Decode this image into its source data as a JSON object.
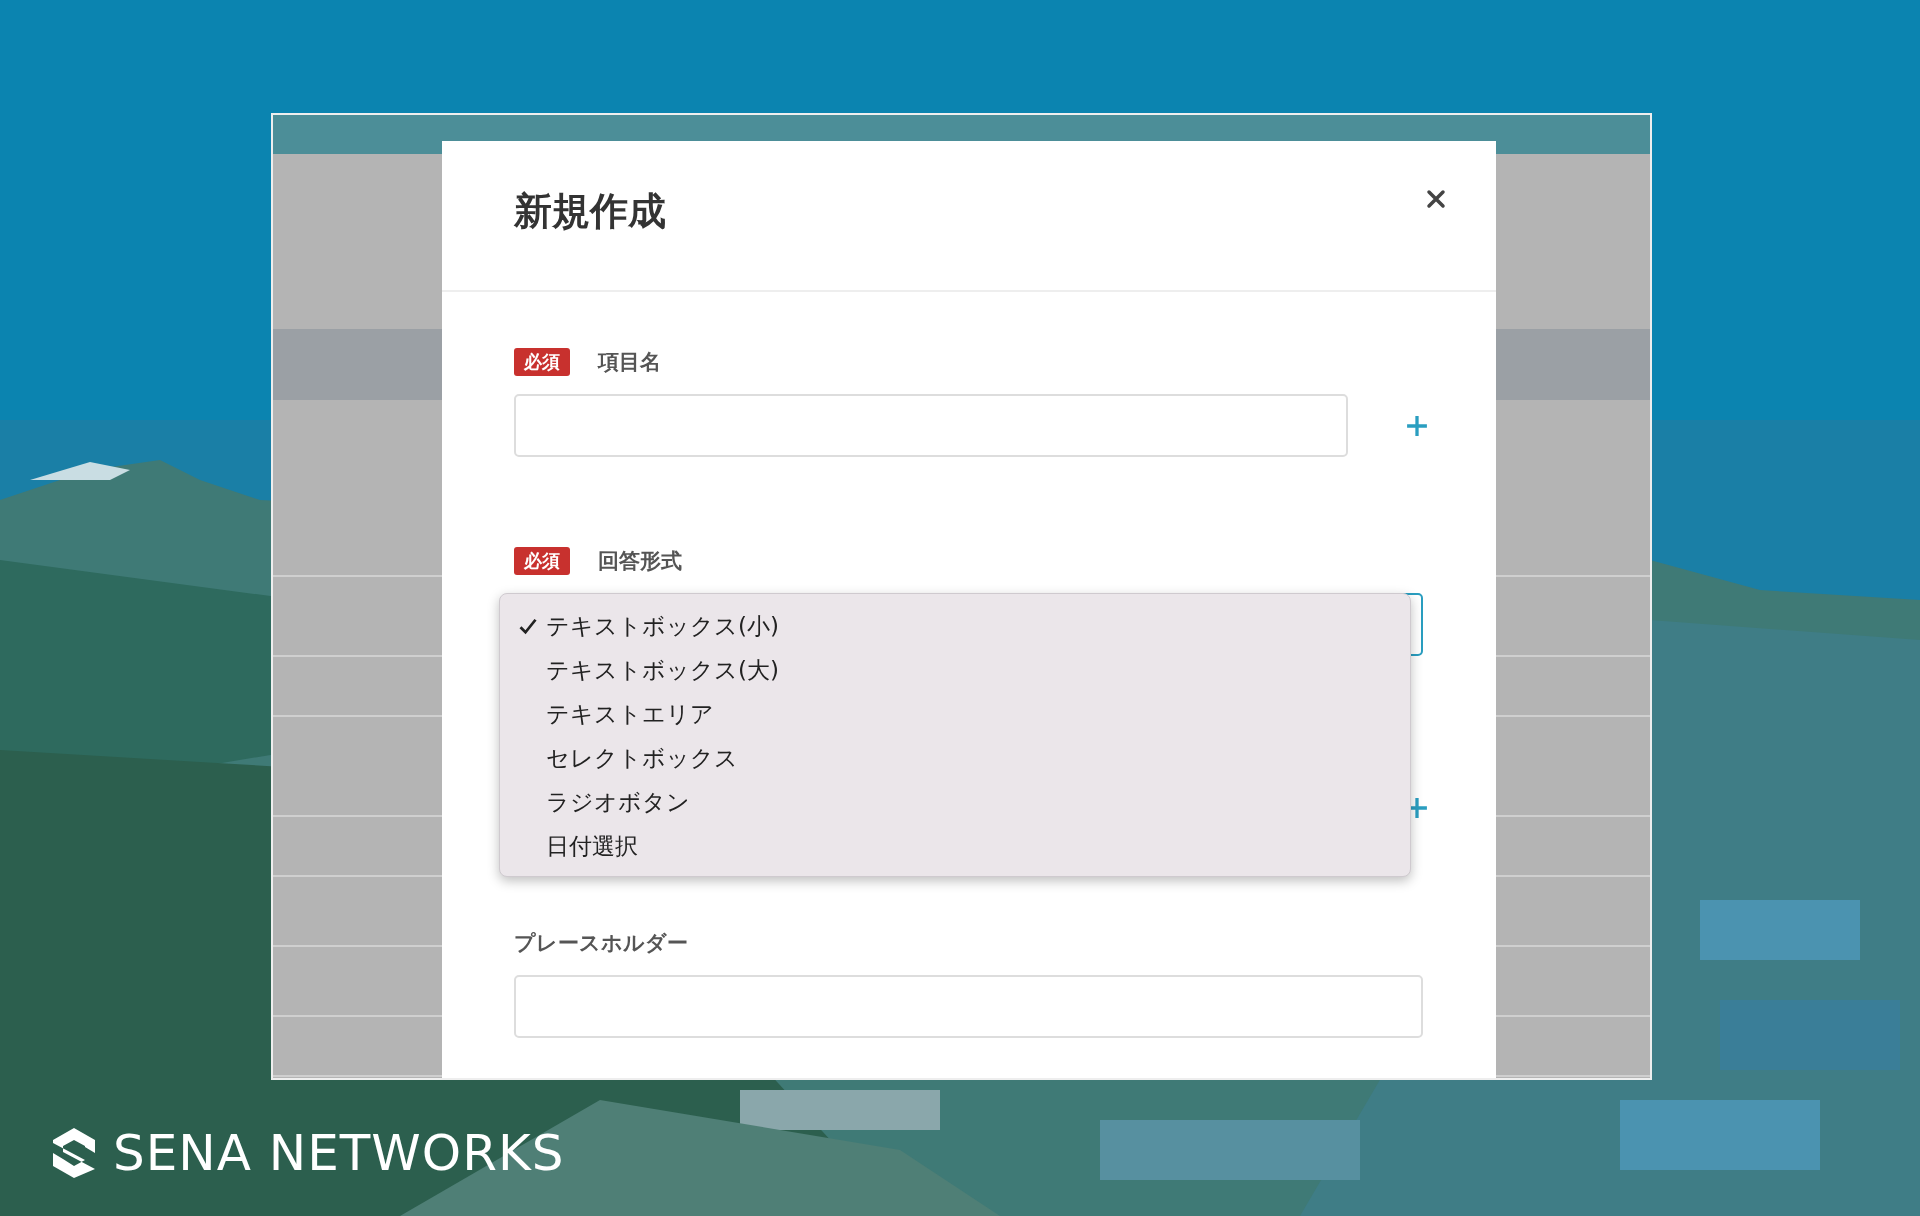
{
  "modal": {
    "title": "新規作成",
    "fields": [
      {
        "kind": "text",
        "badge": "必須",
        "label": "項目名",
        "add": true
      },
      {
        "kind": "select",
        "badge": "必須",
        "label": "回答形式",
        "options": [
          {
            "label": "テキストボックス(小)",
            "selected": true
          },
          {
            "label": "テキストボックス(大)",
            "selected": false
          },
          {
            "label": "テキストエリア",
            "selected": false
          },
          {
            "label": "セレクトボックス",
            "selected": false
          },
          {
            "label": "ラジオボタン",
            "selected": false
          },
          {
            "label": "日付選択",
            "selected": false
          }
        ]
      },
      {
        "kind": "hidden",
        "add": true
      },
      {
        "kind": "text",
        "label": "プレースホルダー"
      }
    ]
  },
  "brand": "SENA NETWORKS"
}
